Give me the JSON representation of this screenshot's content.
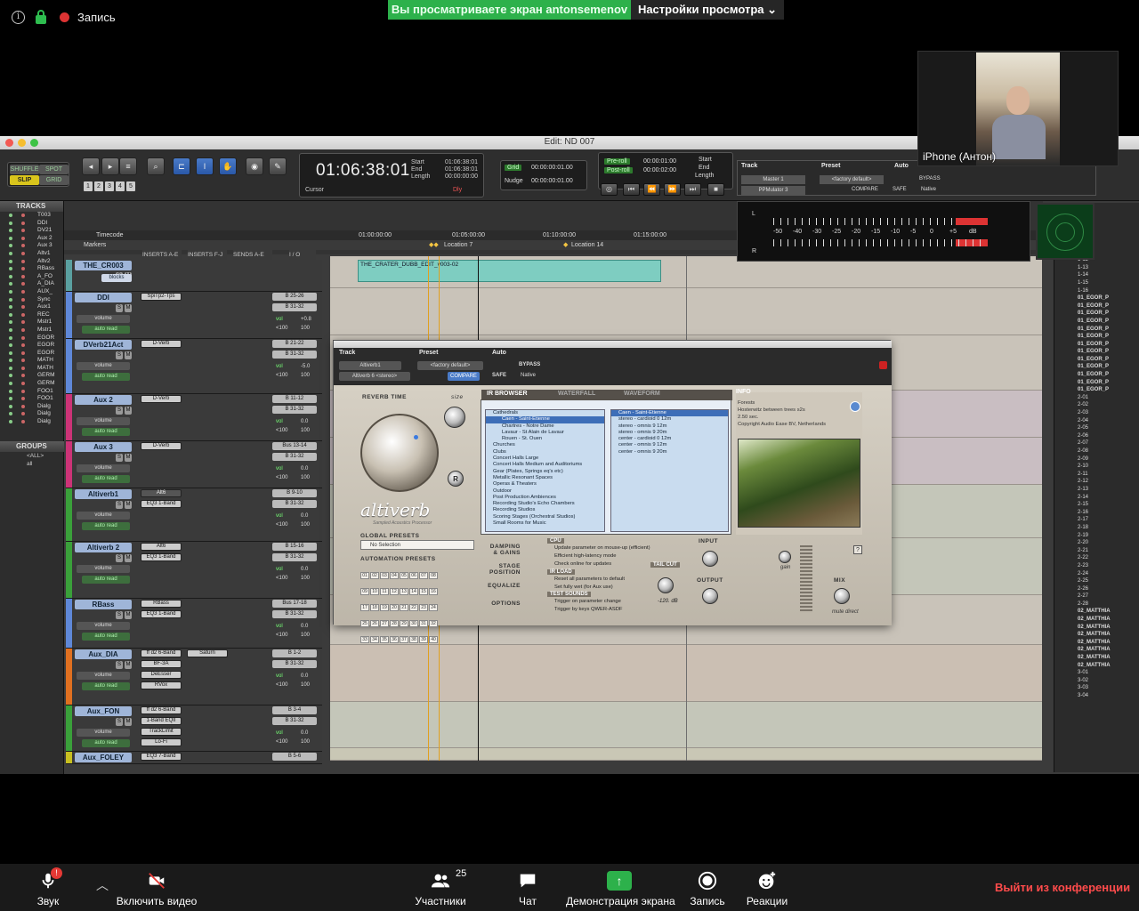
{
  "zoom": {
    "recording_label": "Запись",
    "share_banner": "Вы просматриваете экран antonsemenov",
    "view_options": "Настройки просмотра",
    "participant_name": "iPhone (Антон)",
    "bottom": {
      "audio_label": "Звук",
      "audio_badge": "!",
      "video_label": "Включить видео",
      "participants_label": "Участники",
      "participants_count": "25",
      "chat_label": "Чат",
      "share_label": "Демонстрация экрана",
      "record_label": "Запись",
      "reactions_label": "Реакции",
      "leave_label": "Выйти из конференции"
    }
  },
  "protools": {
    "window_title": "Edit: ND 007",
    "modes": {
      "shuffle": "SHUFFLE",
      "spot": "SPOT",
      "slip": "SLIP",
      "grid": "GRID"
    },
    "zoom_presets": [
      "1",
      "2",
      "3",
      "4",
      "5"
    ],
    "counter": {
      "main": "01:06:38:01",
      "start_label": "Start",
      "start": "01:06:38:01",
      "end_label": "End",
      "end": "01:06:38:01",
      "length_label": "Length",
      "length": "00:00:00:00",
      "cursor_label": "Cursor",
      "dly": "Dly"
    },
    "grid": {
      "grid_label": "Grid",
      "grid_value": "00:00:00:01.00",
      "nudge_label": "Nudge",
      "nudge_value": "00:00:00:01.00"
    },
    "preroll": {
      "pre_label": "Pre-roll",
      "pre_value": "00:00:01:00",
      "post_label": "Post-roll",
      "post_value": "00:00:02:00",
      "start_label": "Start",
      "start": "01:06:38:01",
      "end_label": "End",
      "end": "01:06:38:01",
      "length_label": "Length",
      "length": "00:00:00:00"
    },
    "tracks_header": "TRACKS",
    "tracks_list": [
      "T003",
      "DDI",
      "DV21",
      "Aux 2",
      "Aux 3",
      "Altv1",
      "Altv2",
      "RBass",
      "A_FO",
      "A_DIA",
      "AUX_",
      "Sync",
      "Aux1",
      "REC",
      "Mstr1",
      "Mstr1",
      "EGOR",
      "EGOR",
      "EGOR",
      "MATH",
      "MATH",
      "GERM",
      "GERM",
      "FOO1",
      "FOO1",
      "Dialg",
      "Dialg",
      "Dialg"
    ],
    "groups_header": "GROUPS",
    "groups": [
      "<ALL>",
      "all"
    ],
    "ruler": {
      "timecode_label": "Timecode",
      "markers_label": "Markers",
      "ticks": [
        "01:00:00:00",
        "01:05:00:00",
        "01:10:00:00",
        "01:15:00:00"
      ],
      "location7": "Location 7",
      "location14": "Location 14"
    },
    "columns": {
      "inserts_ae": "INSERTS A-E",
      "inserts_fj": "INSERTS F-J",
      "sends_ae": "SENDS A-E",
      "io": "I / O"
    },
    "tracks": [
      {
        "name": "THE_CR003",
        "color": "#5aa0a0",
        "inserts": [],
        "inserts2": [],
        "io1": "",
        "io2": "",
        "vol": "",
        "pan": "",
        "extra": "blocks"
      },
      {
        "name": "DDI",
        "color": "#5f88d8",
        "inserts": [
          "SpiTp2-Tps"
        ],
        "inserts2": [],
        "io1": "B 25-26",
        "io2": "B 31-32",
        "vol": "+0.8",
        "pan": "100"
      },
      {
        "name": "DVerb21Act",
        "color": "#5f88d8",
        "inserts": [
          "D-Verb"
        ],
        "inserts2": [],
        "io1": "B 21-22",
        "io2": "B 31-32",
        "vol": "-5.0",
        "pan": "100"
      },
      {
        "name": "Aux 2",
        "color": "#cc3377",
        "inserts": [
          "D-Verb"
        ],
        "inserts2": [],
        "io1": "B 11-12",
        "io2": "B 31-32",
        "vol": "0.0",
        "pan": "100"
      },
      {
        "name": "Aux 3",
        "color": "#cc3377",
        "inserts": [
          "D-Verb"
        ],
        "inserts2": [],
        "io1": "Bus 13-14",
        "io2": "B 31-32",
        "vol": "0.0",
        "pan": "100"
      },
      {
        "name": "Altiverb1",
        "color": "#3aa03a",
        "inserts": [
          "Alt6",
          "EQ3 1-Band"
        ],
        "inserts2": [],
        "io1": "B 9-10",
        "io2": "B 31-32",
        "vol": "0.0",
        "pan": "100"
      },
      {
        "name": "Altiverb 2",
        "color": "#3aa03a",
        "inserts": [
          "Alt6",
          "EQ3 1-Band"
        ],
        "inserts2": [],
        "io1": "B 15-16",
        "io2": "B 31-32",
        "vol": "0.0",
        "pan": "100"
      },
      {
        "name": "RBass",
        "color": "#5f88d8",
        "inserts": [
          "RBass",
          "EQ3 1-Band"
        ],
        "inserts2": [],
        "io1": "Bus 17-18",
        "io2": "B 31-32",
        "vol": "0.0",
        "pan": "100"
      },
      {
        "name": "Aux_DIA",
        "color": "#e07020",
        "inserts": [
          "ff d2 6-Band",
          "BF-3A",
          "DeEsser",
          "RVox"
        ],
        "inserts2": [
          "Saturn"
        ],
        "io1": "B 1-2",
        "io2": "B 31-32",
        "vol": "0.0",
        "pan": "100"
      },
      {
        "name": "Aux_FON",
        "color": "#3aa03a",
        "inserts": [
          "ff d2 6-Band",
          "1-Band EQII",
          "TrackLimit",
          "Lo-Fi"
        ],
        "inserts2": [],
        "io1": "B 3-4",
        "io2": "B 31-32",
        "vol": "0.0",
        "pan": "100"
      },
      {
        "name": "Aux_FOLEY",
        "color": "#c8c020",
        "inserts": [
          "EQ3 7-Band"
        ],
        "inserts2": [],
        "io1": "B 5-6",
        "io2": "",
        "vol": "",
        "pan": ""
      }
    ],
    "strip_labels": {
      "volume": "volume",
      "auto_read": "auto read",
      "vol": "vol",
      "pan_left": "<100"
    },
    "clip_name": "THE_CRATER_DUBB_EDIT_v003-02",
    "master": {
      "track_label": "Track",
      "preset_label": "Preset",
      "auto_label": "Auto",
      "track": "Master 1",
      "insert": "PPMulator 3",
      "preset": "<factory default>",
      "compare": "COMPARE",
      "bypass": "BYPASS",
      "safe": "SAFE",
      "native": "Native",
      "meter_scale": [
        "-50",
        "-40",
        "-30",
        "-25",
        "-20",
        "-15",
        "-10",
        "-5",
        "0",
        "+5",
        "dB"
      ],
      "l": "L",
      "r": "R"
    },
    "right_list": [
      "1-05",
      "1-06",
      "1-07",
      "1-08",
      "1-09",
      "1-10",
      "1-11",
      "1-12",
      "1-13",
      "1-14",
      "1-15",
      "1-16",
      "01_EGOR_P",
      "01_EGOR_P",
      "01_EGOR_P",
      "01_EGOR_P",
      "01_EGOR_P",
      "01_EGOR_P",
      "01_EGOR_P",
      "01_EGOR_P",
      "01_EGOR_P",
      "01_EGOR_P",
      "01_EGOR_P",
      "01_EGOR_P",
      "01_EGOR_P",
      "2-01",
      "2-02",
      "2-03",
      "2-04",
      "2-05",
      "2-06",
      "2-07",
      "2-08",
      "2-09",
      "2-10",
      "2-11",
      "2-12",
      "2-13",
      "2-14",
      "2-15",
      "2-16",
      "2-17",
      "2-18",
      "2-19",
      "2-20",
      "2-21",
      "2-22",
      "2-23",
      "2-24",
      "2-25",
      "2-26",
      "2-27",
      "2-28",
      "02_MATTHIA",
      "02_MATTHIA",
      "02_MATTHIA",
      "02_MATTHIA",
      "02_MATTHIA",
      "02_MATTHIA",
      "02_MATTHIA",
      "02_MATTHIA",
      "3-01",
      "3-02",
      "3-03",
      "3-04"
    ]
  },
  "altiverb": {
    "track_label": "Track",
    "preset_label": "Preset",
    "auto_label": "Auto",
    "track": "Altiverb1",
    "insert": "Altiverb 6 <stereo>",
    "preset": "<factory default>",
    "compare": "COMPARE",
    "bypass": "BYPASS",
    "safe": "SAFE",
    "native": "Native",
    "reverb_time": "REVERB TIME",
    "rt_small": "size",
    "brand": "altiverb",
    "brand_sub": "Sampled Acoustics Processor",
    "tabs": {
      "ir_browser": "IR BROWSER",
      "waterfall": "WATERFALL",
      "waveform": "WAVEFORM",
      "info": "INFO"
    },
    "ir_tree": [
      {
        "t": "Cathedrals",
        "c": ""
      },
      {
        "t": "Caen - Saint-Etienne",
        "c": "sel sub"
      },
      {
        "t": "Chartres - Notre Dame",
        "c": "sub"
      },
      {
        "t": "Lavaur - St Alain de Lavaur",
        "c": "sub"
      },
      {
        "t": "Rouen - St. Ouen",
        "c": "sub"
      },
      {
        "t": "Churches",
        "c": ""
      },
      {
        "t": "Clubs",
        "c": ""
      },
      {
        "t": "Concert Halls Large",
        "c": ""
      },
      {
        "t": "Concert Halls Medium and Auditoriums",
        "c": ""
      },
      {
        "t": "Gear (Plates, Springs eq's etc)",
        "c": ""
      },
      {
        "t": "Metallic Resonant Spaces",
        "c": ""
      },
      {
        "t": "Operas & Theaters",
        "c": ""
      },
      {
        "t": "Outdoor",
        "c": ""
      },
      {
        "t": "Post Production Ambiences",
        "c": ""
      },
      {
        "t": "Recording Studio's Echo Chambers",
        "c": ""
      },
      {
        "t": "Recording Studios",
        "c": ""
      },
      {
        "t": "Scoring Stages (Orchestral Studios)",
        "c": ""
      },
      {
        "t": "Small Rooms for Music",
        "c": ""
      }
    ],
    "ir_files_title": "Caen - Saint-Etienne",
    "ir_files": [
      "stereo - cardioid 0 12m",
      "stereo - omnis 9 12m",
      "stereo - omnis 9 20m",
      "center - cardioid 0 12m",
      "center - omnis 9 12m",
      "center - omnis 9 20m"
    ],
    "info_lines": [
      "Forests",
      "Hosterwitz between trees s2s",
      "2.50 sec.",
      "Copyright Audio Ease BV, Netherlands"
    ],
    "global_presets": "GLOBAL PRESETS",
    "no_selection": "No Selection",
    "automation_presets": "AUTOMATION PRESETS",
    "preset_cells": [
      "01",
      "02",
      "03",
      "04",
      "05",
      "06",
      "07",
      "08",
      "09",
      "10",
      "11",
      "12",
      "13",
      "14",
      "15",
      "16",
      "17",
      "18",
      "19",
      "20",
      "21",
      "22",
      "23",
      "24",
      "25",
      "26",
      "27",
      "28",
      "29",
      "30",
      "31",
      "32",
      "33",
      "34",
      "35",
      "36",
      "37",
      "38",
      "39",
      "40"
    ],
    "damping": "DAMPING & GAINS",
    "stage": "STAGE POSITION",
    "equalize": "EQUALIZE",
    "options": "OPTIONS",
    "cpu": "CPU",
    "cpu_lines": [
      "Update parameter on mouse-up (efficient)",
      "Efficient high-latency mode",
      "Check online for updates"
    ],
    "ir_load": "IR LOAD",
    "ir_load_lines": [
      "Reset all parameters to default",
      "Set fully wet (for Aux use)"
    ],
    "test_sounds": "TEST SOUNDS",
    "test_lines": [
      "Trigger on parameter change",
      "Trigger by keys QWER-ASDF"
    ],
    "tail_cut": "TAIL CUT",
    "tail_value": "-120. dB",
    "input": "INPUT",
    "output": "OUTPUT",
    "gain": "gain",
    "mix": "MIX",
    "mute_direct": "mute direct"
  }
}
